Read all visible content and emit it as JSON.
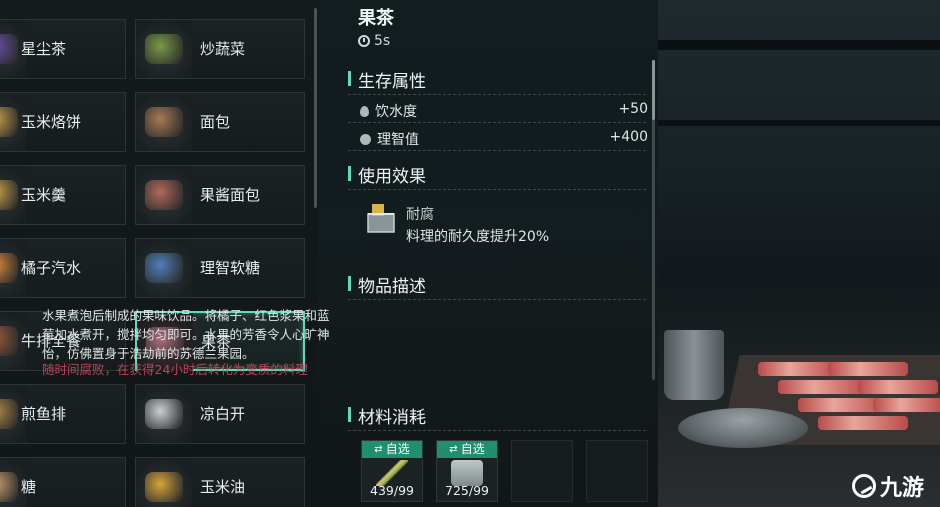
{
  "recipes": [
    {
      "name": "星尘茶",
      "col": "left",
      "icon": "cup-icon",
      "color": "#6a4fa3"
    },
    {
      "name": "炒蔬菜",
      "col": "right",
      "icon": "vegetable-bowl-icon",
      "color": "#7a9a48"
    },
    {
      "name": "玉米烙饼",
      "col": "left",
      "icon": "pancake-icon",
      "color": "#c9a04a"
    },
    {
      "name": "面包",
      "col": "right",
      "icon": "bread-icon",
      "color": "#a97a52"
    },
    {
      "name": "玉米羹",
      "col": "left",
      "icon": "soup-icon",
      "color": "#c9a04a"
    },
    {
      "name": "果酱面包",
      "col": "right",
      "icon": "jam-bread-icon",
      "color": "#b06a5a"
    },
    {
      "name": "橘子汽水",
      "col": "left",
      "icon": "soda-icon",
      "color": "#d88a3a"
    },
    {
      "name": "理智软糖",
      "col": "right",
      "icon": "candy-icon",
      "color": "#4f7fb8"
    },
    {
      "name": "牛排全餐",
      "col": "left",
      "icon": "steak-icon",
      "color": "#9a5a3a"
    },
    {
      "name": "果茶",
      "col": "right",
      "icon": "fruit-tea-icon",
      "color": "#b06f7c",
      "selected": true
    },
    {
      "name": "煎鱼排",
      "col": "left",
      "icon": "fish-icon",
      "color": "#b0884a"
    },
    {
      "name": "凉白开",
      "col": "right",
      "icon": "water-mug-icon",
      "color": "#c8d0d0"
    },
    {
      "name": "糖",
      "col": "left",
      "icon": "sugar-icon",
      "color": "#c8a070"
    },
    {
      "name": "玉米油",
      "col": "right",
      "icon": "oil-bottle-icon",
      "color": "#d6a43a"
    }
  ],
  "detail": {
    "title": "果茶",
    "time": "5s",
    "sections": {
      "survival": "生存属性",
      "effect": "使用效果",
      "description": "物品描述",
      "materials": "材料消耗"
    },
    "stats": [
      {
        "label": "饮水度",
        "value": "+50",
        "icon": "water-drop-icon"
      },
      {
        "label": "理智值",
        "value": "+400",
        "icon": "brain-icon"
      }
    ],
    "effect": {
      "title": "耐腐",
      "desc": "料理的耐久度提升20%"
    },
    "description": "水果煮泡后制成的果味饮品。将橘子、红色浆果和蓝莓加水煮开，搅拌均匀即可。水果的芳香令人心旷神怡，仿佛置身于浩劫前的苏德兰果园。",
    "warning": "随时间腐败，在获得24小时后转化为变质的料理",
    "materials": [
      {
        "tag": "自选",
        "count": "439/99",
        "icon": "herb-icon"
      },
      {
        "tag": "自选",
        "count": "725/99",
        "icon": "water-mug-icon"
      },
      {
        "empty": true
      },
      {
        "empty": true
      }
    ]
  },
  "watermark": "九游"
}
